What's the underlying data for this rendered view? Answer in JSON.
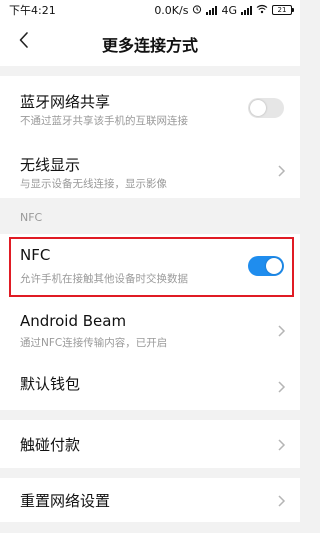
{
  "status_bar": {
    "time": "下午4:21",
    "speed": "0.0K/s",
    "network": "4G",
    "battery": "21"
  },
  "header": {
    "title": "更多连接方式",
    "back_icon": "chevron-left-icon"
  },
  "items": {
    "bluetooth_share": {
      "title": "蓝牙网络共享",
      "subtitle": "不通过蓝牙共享该手机的互联网连接",
      "toggle": "off"
    },
    "wireless_display": {
      "title": "无线显示",
      "subtitle": "与显示设备无线连接，显示影像"
    },
    "nfc_section_label": "NFC",
    "nfc": {
      "title": "NFC",
      "subtitle": "允许手机在接触其他设备时交换数据",
      "toggle": "on"
    },
    "android_beam": {
      "title": "Android Beam",
      "subtitle": "通过NFC连接传输内容，已开启"
    },
    "default_wallet": {
      "title": "默认钱包"
    },
    "tap_pay": {
      "title": "触碰付款"
    },
    "reset_network": {
      "title": "重置网络设置"
    }
  },
  "colors": {
    "accent": "#1f8dee",
    "highlight": "#e01b24",
    "background": "#f2f2f2",
    "subtitle": "#9a9a9a"
  }
}
